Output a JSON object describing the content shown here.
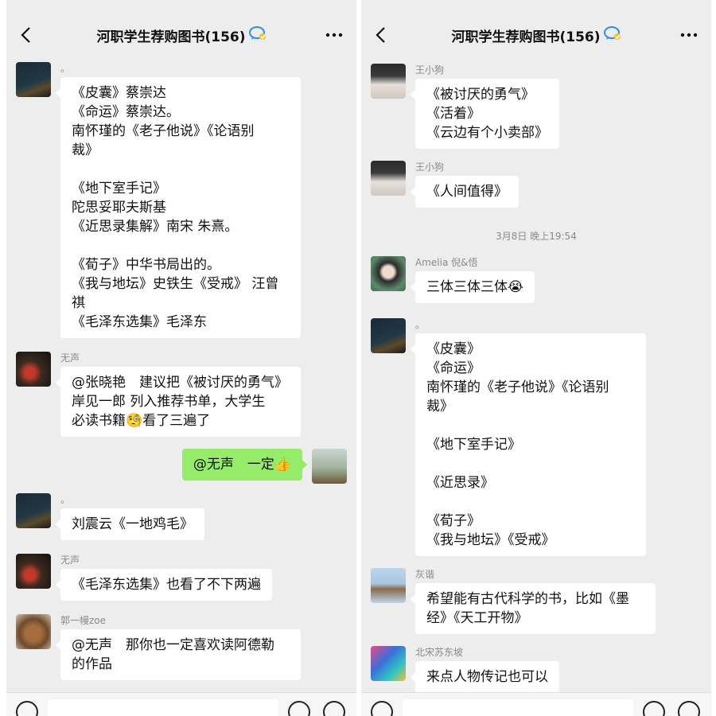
{
  "left": {
    "title": "河职学生荐购图书(156)",
    "messages": [
      {
        "sender": "。",
        "text": "《皮囊》蔡崇达\n《命运》蔡崇达。\n南怀瑾的《老子他说》《论语别\n裁》\n\n《地下室手记》\n陀思妥耶夫斯基\n《近思录集解》南宋 朱熹。\n\n《荀子》中华书局出的。\n《我与地坛》史铁生《受戒》 汪曾\n祺\n《毛泽东选集》毛泽东"
      },
      {
        "sender": "无声",
        "text": "@张晓艳　建议把《被讨厌的勇气》\n岸见一郎 列入推荐书单，大学生\n必读书籍🧐看了三遍了"
      },
      {
        "sender": "",
        "text": "@无声　一定👍"
      },
      {
        "sender": "。",
        "text": "刘震云《一地鸡毛》"
      },
      {
        "sender": "无声",
        "text": "《毛泽东选集》也看了不下两遍"
      },
      {
        "sender": "郭一幔zoe",
        "text": "@无声　那你也一定喜欢读阿德勒\n的作品"
      }
    ]
  },
  "right": {
    "title": "河职学生荐购图书(156)",
    "timestamp": "3月8日 晚上19:54",
    "messages": [
      {
        "sender": "王小狗",
        "text": "《被讨厌的勇气》\n《活着》\n《云边有个小卖部》"
      },
      {
        "sender": "王小狗",
        "text": "《人间值得》"
      },
      {
        "sender": "Amelia 倪&悟",
        "text": "三体三体三体😭"
      },
      {
        "sender": "。",
        "text": "《皮囊》\n《命运》\n南怀瑾的《老子他说》《论语别\n裁》\n\n《地下室手记》\n\n《近思录》\n\n《荀子》\n《我与地坛》《受戒》"
      },
      {
        "sender": "灰谐",
        "text": "希望能有古代科学的书，比如《墨\n经》《天工开物》"
      },
      {
        "sender": "北宋苏东坡",
        "text": "来点人物传记也可以"
      }
    ]
  },
  "colors": {
    "background": "#ededed",
    "bubble_in": "#ffffff",
    "bubble_out": "#95ec69",
    "sender_gray": "#8a8a8a",
    "group_badge": "#2f8cf0"
  },
  "icons": [
    "back-arrow-icon",
    "group-badge-icon",
    "more-dots-icon",
    "voice-icon",
    "emoji-icon",
    "plus-icon"
  ]
}
